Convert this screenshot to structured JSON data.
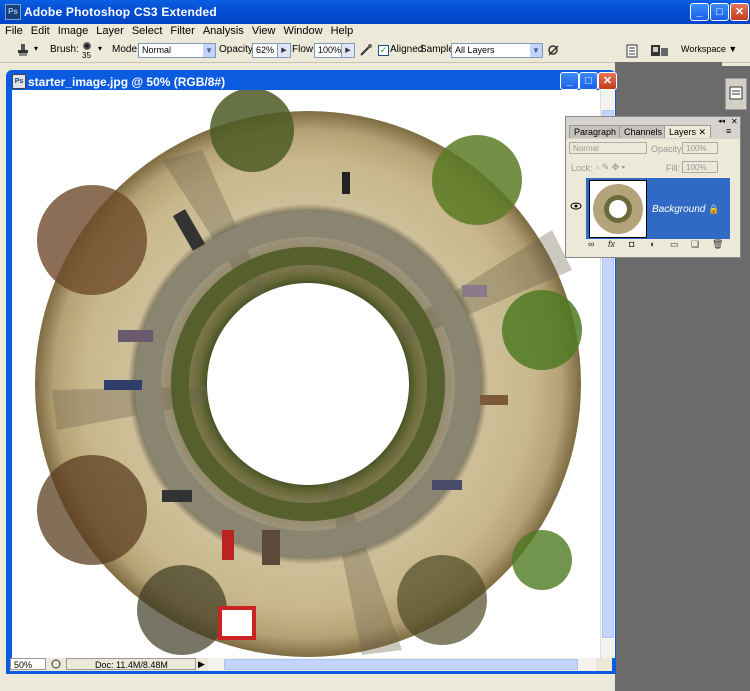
{
  "app": {
    "title": "Adobe Photoshop CS3 Extended",
    "icon_text": "Ps"
  },
  "window_controls": {
    "minimize": "_",
    "maximize": "□",
    "close": "✕"
  },
  "menu": [
    "File",
    "Edit",
    "Image",
    "Layer",
    "Select",
    "Filter",
    "Analysis",
    "View",
    "Window",
    "Help"
  ],
  "options": {
    "brush_label": "Brush:",
    "brush_size": "35",
    "mode_label": "Mode:",
    "mode_value": "Normal",
    "opacity_label": "Opacity:",
    "opacity_value": "62%",
    "flow_label": "Flow:",
    "flow_value": "100%",
    "aligned_label": "Aligned",
    "sample_label": "Sample:",
    "sample_value": "All Layers",
    "workspace_label": "Workspace ▼"
  },
  "document": {
    "title": "starter_image.jpg @ 50% (RGB/8#)",
    "zoom": "50%",
    "doc_info": "Doc: 11.4M/8.48M"
  },
  "layers_panel": {
    "tabs": [
      "Paragraph",
      "Channels",
      "Layers"
    ],
    "blend_mode": "Normal",
    "opacity_label": "Opacity:",
    "opacity_value": "100%",
    "lock_label": "Lock:",
    "fill_label": "Fill:",
    "fill_value": "100%",
    "layer_name": "Background"
  },
  "colors": {
    "xp_blue": "#0054e3",
    "selection": "#316ac5",
    "chrome": "#ece9d8",
    "workspace_gray": "#6b6b6b"
  }
}
